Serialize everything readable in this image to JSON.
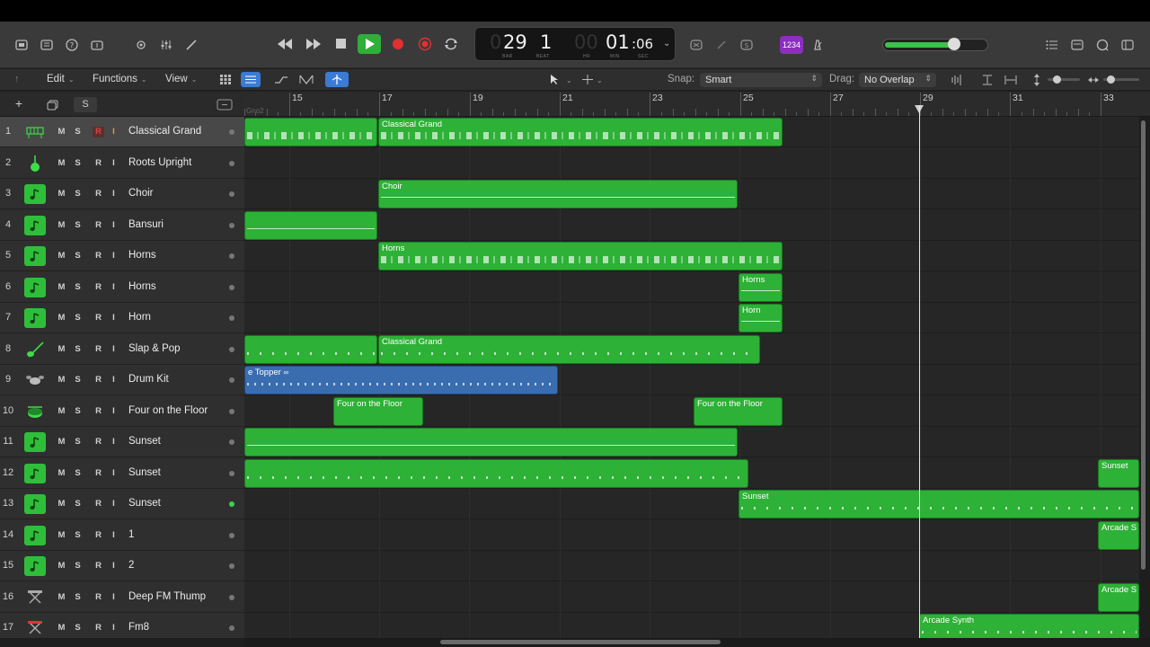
{
  "transport": {
    "bar": "29",
    "beat": "1",
    "hr_dim": "00",
    "min": "01",
    "sec": "06",
    "labels": {
      "bar": "BAR",
      "beat": "BEAT",
      "hr": "HR",
      "min": "MIN",
      "sec": "SEC"
    },
    "count_in": "1234"
  },
  "menubar": {
    "edit": "Edit",
    "functions": "Functions",
    "view": "View",
    "snap_label": "Snap:",
    "snap_value": "Smart",
    "drag_label": "Drag:",
    "drag_value": "No Overlap"
  },
  "track_header": {
    "add": "+",
    "solo": "S"
  },
  "ruler": {
    "prefix": "Gno2",
    "bars": [
      "15",
      "17",
      "19",
      "21",
      "23",
      "25",
      "27",
      "29",
      "31",
      "33"
    ]
  },
  "tracks": [
    {
      "num": "1",
      "name": "Classical Grand",
      "icon": "piano-icon"
    },
    {
      "num": "2",
      "name": "Roots Upright",
      "icon": "upright-bass-icon"
    },
    {
      "num": "3",
      "name": "Choir",
      "icon": "music-note-icon"
    },
    {
      "num": "4",
      "name": "Bansuri",
      "icon": "music-note-icon"
    },
    {
      "num": "5",
      "name": "Horns",
      "icon": "music-note-icon"
    },
    {
      "num": "6",
      "name": "Horns",
      "icon": "music-note-icon"
    },
    {
      "num": "7",
      "name": "Horn",
      "icon": "music-note-icon"
    },
    {
      "num": "8",
      "name": "Slap & Pop",
      "icon": "bass-guitar-icon"
    },
    {
      "num": "9",
      "name": "Drum Kit",
      "icon": "drum-kit-icon"
    },
    {
      "num": "10",
      "name": "Four on the Floor",
      "icon": "drum-machine-icon"
    },
    {
      "num": "11",
      "name": "Sunset",
      "icon": "music-note-icon"
    },
    {
      "num": "12",
      "name": "Sunset",
      "icon": "music-note-icon"
    },
    {
      "num": "13",
      "name": "Sunset",
      "icon": "music-note-icon"
    },
    {
      "num": "14",
      "name": "1",
      "icon": "music-note-icon"
    },
    {
      "num": "15",
      "name": "2",
      "icon": "music-note-icon"
    },
    {
      "num": "16",
      "name": "Deep FM Thump",
      "icon": "synth-icon"
    },
    {
      "num": "17",
      "name": "Fm8",
      "icon": "synth-red-icon"
    }
  ],
  "track_buttons": {
    "mute": "M",
    "solo": "S",
    "record": "R",
    "input": "I"
  },
  "regions": {
    "classical_grand_1": "Classical Grand",
    "choir": "Choir",
    "horns_main": "Horns",
    "horns_short": "Horns",
    "horn_short": "Horn",
    "classical_grand_8": "Classical Grand",
    "drum_topper": "e Topper",
    "four_floor_a": "Four on the Floor",
    "four_floor_b": "Four on the Floor",
    "sunset_12b": "Sunset",
    "sunset_13": "Sunset",
    "arcade_14": "Arcade S",
    "arcade_16": "Arcade S",
    "arcade_17": "Arcade Synth"
  },
  "colors": {
    "region_green": "#2db136",
    "region_blue": "#3a6db0",
    "accent_blue": "#3a7bd5",
    "record_red": "#e03030",
    "count_in_purple": "#8a2fc0"
  }
}
